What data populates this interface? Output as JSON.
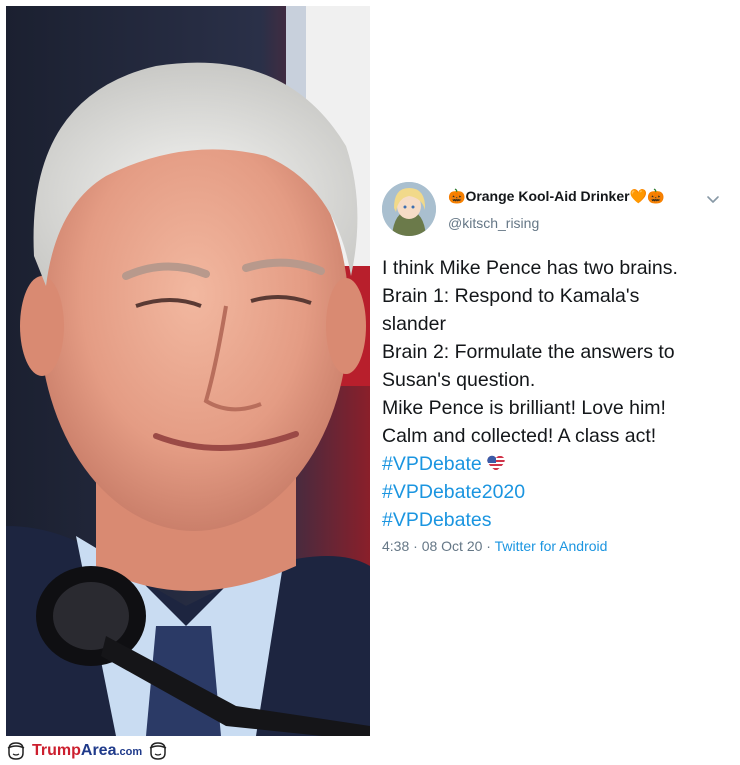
{
  "tweet": {
    "display_name_prefix_emoji": "🎃",
    "display_name": "Orange Kool-Aid Drinker",
    "display_name_suffix_emoji": "🧡🎃",
    "handle": "@kitsch_rising",
    "menu_icon": "chevron-down-icon",
    "lines": [
      "I think Mike Pence has two brains.",
      "Brain 1: Respond to Kamala's",
      "slander",
      "Brain 2: Formulate the answers to",
      "Susan's question.",
      "Mike Pence is brilliant! Love him!",
      "Calm and collected! A class act!"
    ],
    "hashtags": [
      "#VPDebate",
      "#VPDebate2020",
      "#VPDebates"
    ],
    "hashtag_emoji_icon": "usa-heart-icon",
    "time": "4:38",
    "date": "08 Oct 20",
    "separator": "·",
    "source": "Twitter for Android"
  },
  "watermark": {
    "trump": "Trump",
    "area": "Area",
    "com": ".com"
  },
  "colors": {
    "link": "#1b95e0",
    "muted": "#657786",
    "text": "#14171a",
    "brand_red": "#cc1f2e",
    "brand_blue": "#1f3a8a"
  }
}
